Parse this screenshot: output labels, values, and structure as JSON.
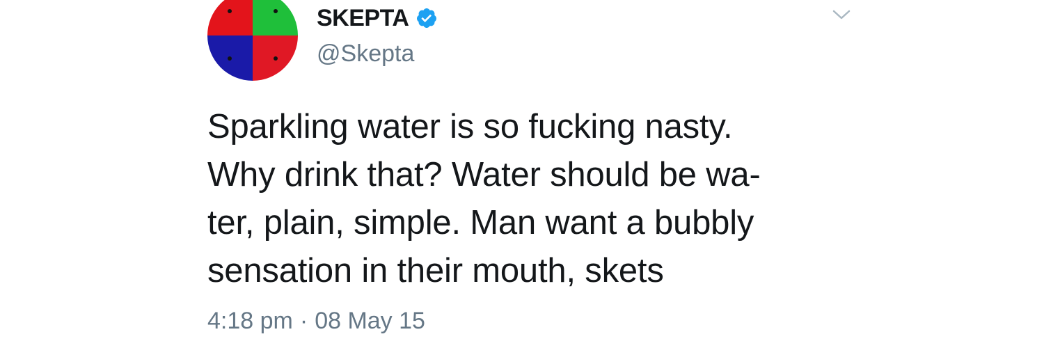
{
  "tweet": {
    "author": {
      "display_name": "SKEPTA",
      "handle": "@Skepta",
      "verified": true,
      "avatar_icon": "four-color-quadrant-avatar",
      "avatar_colors": [
        "#e3141b",
        "#1fbf3a",
        "#1a1aa8",
        "#e01825"
      ]
    },
    "text_lines": [
      "Sparkling water is so fucking nasty.",
      "Why drink that? Water should be wa-",
      "ter, plain, simple. Man want a bubbly",
      "sensation in their mouth, skets"
    ],
    "time": "4:18 pm",
    "separator": "·",
    "date": "08 May 15",
    "menu_icon": "chevron-down-icon",
    "colors": {
      "text": "#14171a",
      "secondary": "#657786",
      "verified_badge": "#1da1f2",
      "chevron": "#aab8c2"
    }
  }
}
